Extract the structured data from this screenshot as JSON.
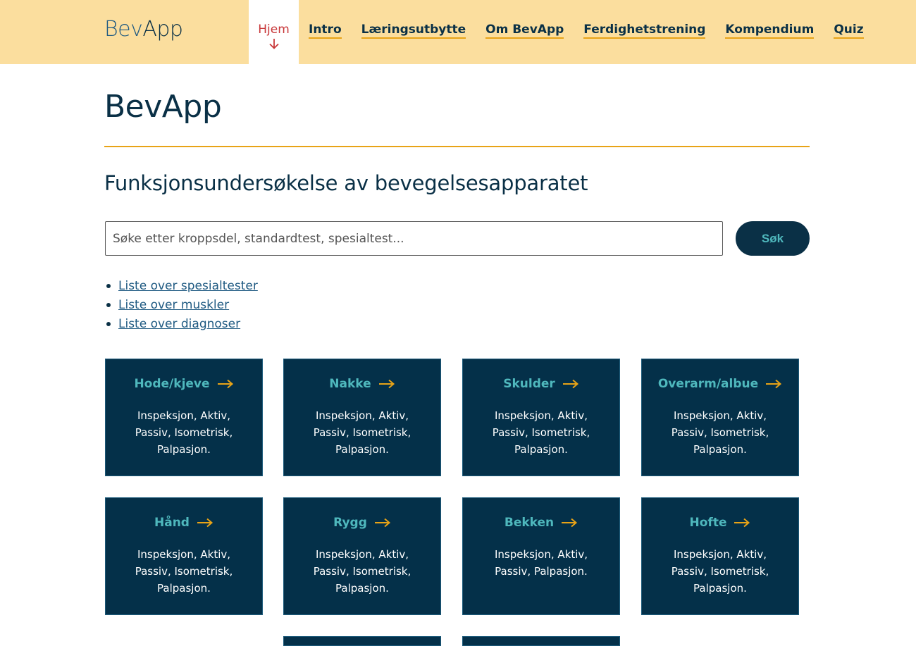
{
  "header": {
    "logo_bev": "Bev",
    "logo_app": "App",
    "nav": [
      {
        "label": "Hjem",
        "active": true
      },
      {
        "label": "Intro"
      },
      {
        "label": "Læringsutbytte"
      },
      {
        "label": "Om BevApp"
      },
      {
        "label": "Ferdighetstrening"
      },
      {
        "label": "Kompendium"
      },
      {
        "label": "Quiz"
      }
    ]
  },
  "main": {
    "title": "BevApp",
    "subtitle": "Funksjonsundersøkelse av bevegelsesapparatet",
    "search": {
      "placeholder": "Søke etter kroppsdel, standardtest, spesialtest...",
      "button_label": "Søk"
    },
    "links": [
      "Liste over spesialtester",
      "Liste over muskler",
      "Liste over diagnoser"
    ],
    "cards": [
      {
        "title": "Hode/kjeve",
        "desc": "Inspeksjon, Aktiv, Passiv, Isometrisk, Palpasjon."
      },
      {
        "title": "Nakke",
        "desc": "Inspeksjon, Aktiv, Passiv, Isometrisk, Palpasjon."
      },
      {
        "title": "Skulder",
        "desc": "Inspeksjon, Aktiv, Passiv, Isometrisk, Palpasjon."
      },
      {
        "title": "Overarm/albue",
        "desc": "Inspeksjon, Aktiv, Passiv, Isometrisk, Palpasjon."
      },
      {
        "title": "Hånd",
        "desc": "Inspeksjon, Aktiv, Passiv, Isometrisk, Palpasjon."
      },
      {
        "title": "Rygg",
        "desc": "Inspeksjon, Aktiv, Passiv, Isometrisk, Palpasjon."
      },
      {
        "title": "Bekken",
        "desc": "Inspeksjon, Aktiv, Passiv, Palpasjon."
      },
      {
        "title": "Hofte",
        "desc": "Inspeksjon, Aktiv, Passiv, Isometrisk, Palpasjon."
      }
    ]
  },
  "colors": {
    "header_bg": "#fbde9e",
    "navy": "#043049",
    "accent": "#e8a317",
    "teal": "#4fb8bd",
    "active_nav": "#c8383a"
  }
}
